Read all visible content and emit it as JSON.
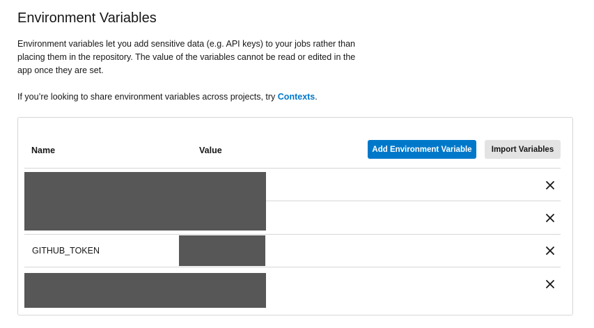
{
  "page": {
    "title": "Environment Variables",
    "description": "Environment variables let you add sensitive data (e.g. API keys) to your jobs rather than placing them in the repository. The value of the variables cannot be read or edited in the app once they are set.",
    "contexts_prefix": "If you’re looking to share environment variables across projects, try ",
    "contexts_link": "Contexts",
    "contexts_suffix": "."
  },
  "table": {
    "headers": {
      "name": "Name",
      "value": "Value"
    },
    "buttons": {
      "add": "Add Environment Variable",
      "import": "Import Variables"
    },
    "rows": [
      {
        "name": ""
      },
      {
        "name": ""
      },
      {
        "name": "GITHUB_TOKEN"
      },
      {
        "name": ""
      }
    ]
  },
  "icons": {
    "delete": "close-icon"
  },
  "colors": {
    "accent": "#0078ca",
    "redaction": "#575757",
    "secondary_button": "#e3e3e3",
    "border": "#d6d6d6"
  }
}
